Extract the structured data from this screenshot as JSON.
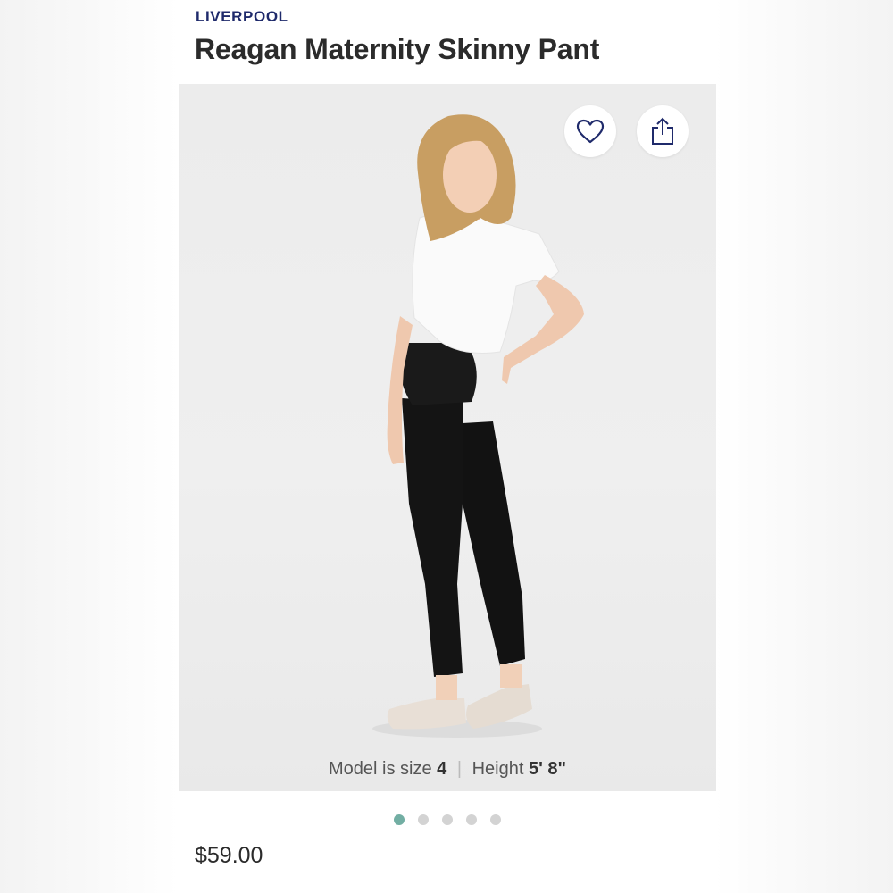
{
  "product": {
    "brand": "LIVERPOOL",
    "title": "Reagan Maternity Skinny Pant",
    "price": "$59.00"
  },
  "actions": {
    "favorite_icon": "heart-outline-icon",
    "share_icon": "share-upload-icon"
  },
  "caption": {
    "size_prefix": "Model is size",
    "size_value": "4",
    "separator": "|",
    "height_prefix": "Height",
    "height_value": "5' 8\""
  },
  "gallery": {
    "dots": [
      {
        "active": true
      },
      {
        "active": false
      },
      {
        "active": false
      },
      {
        "active": false
      },
      {
        "active": false
      }
    ],
    "active_index": 0
  },
  "colors": {
    "brand": "#1f2a6b",
    "active_dot": "#72aea3",
    "inactive_dot": "#d3d3d3"
  }
}
